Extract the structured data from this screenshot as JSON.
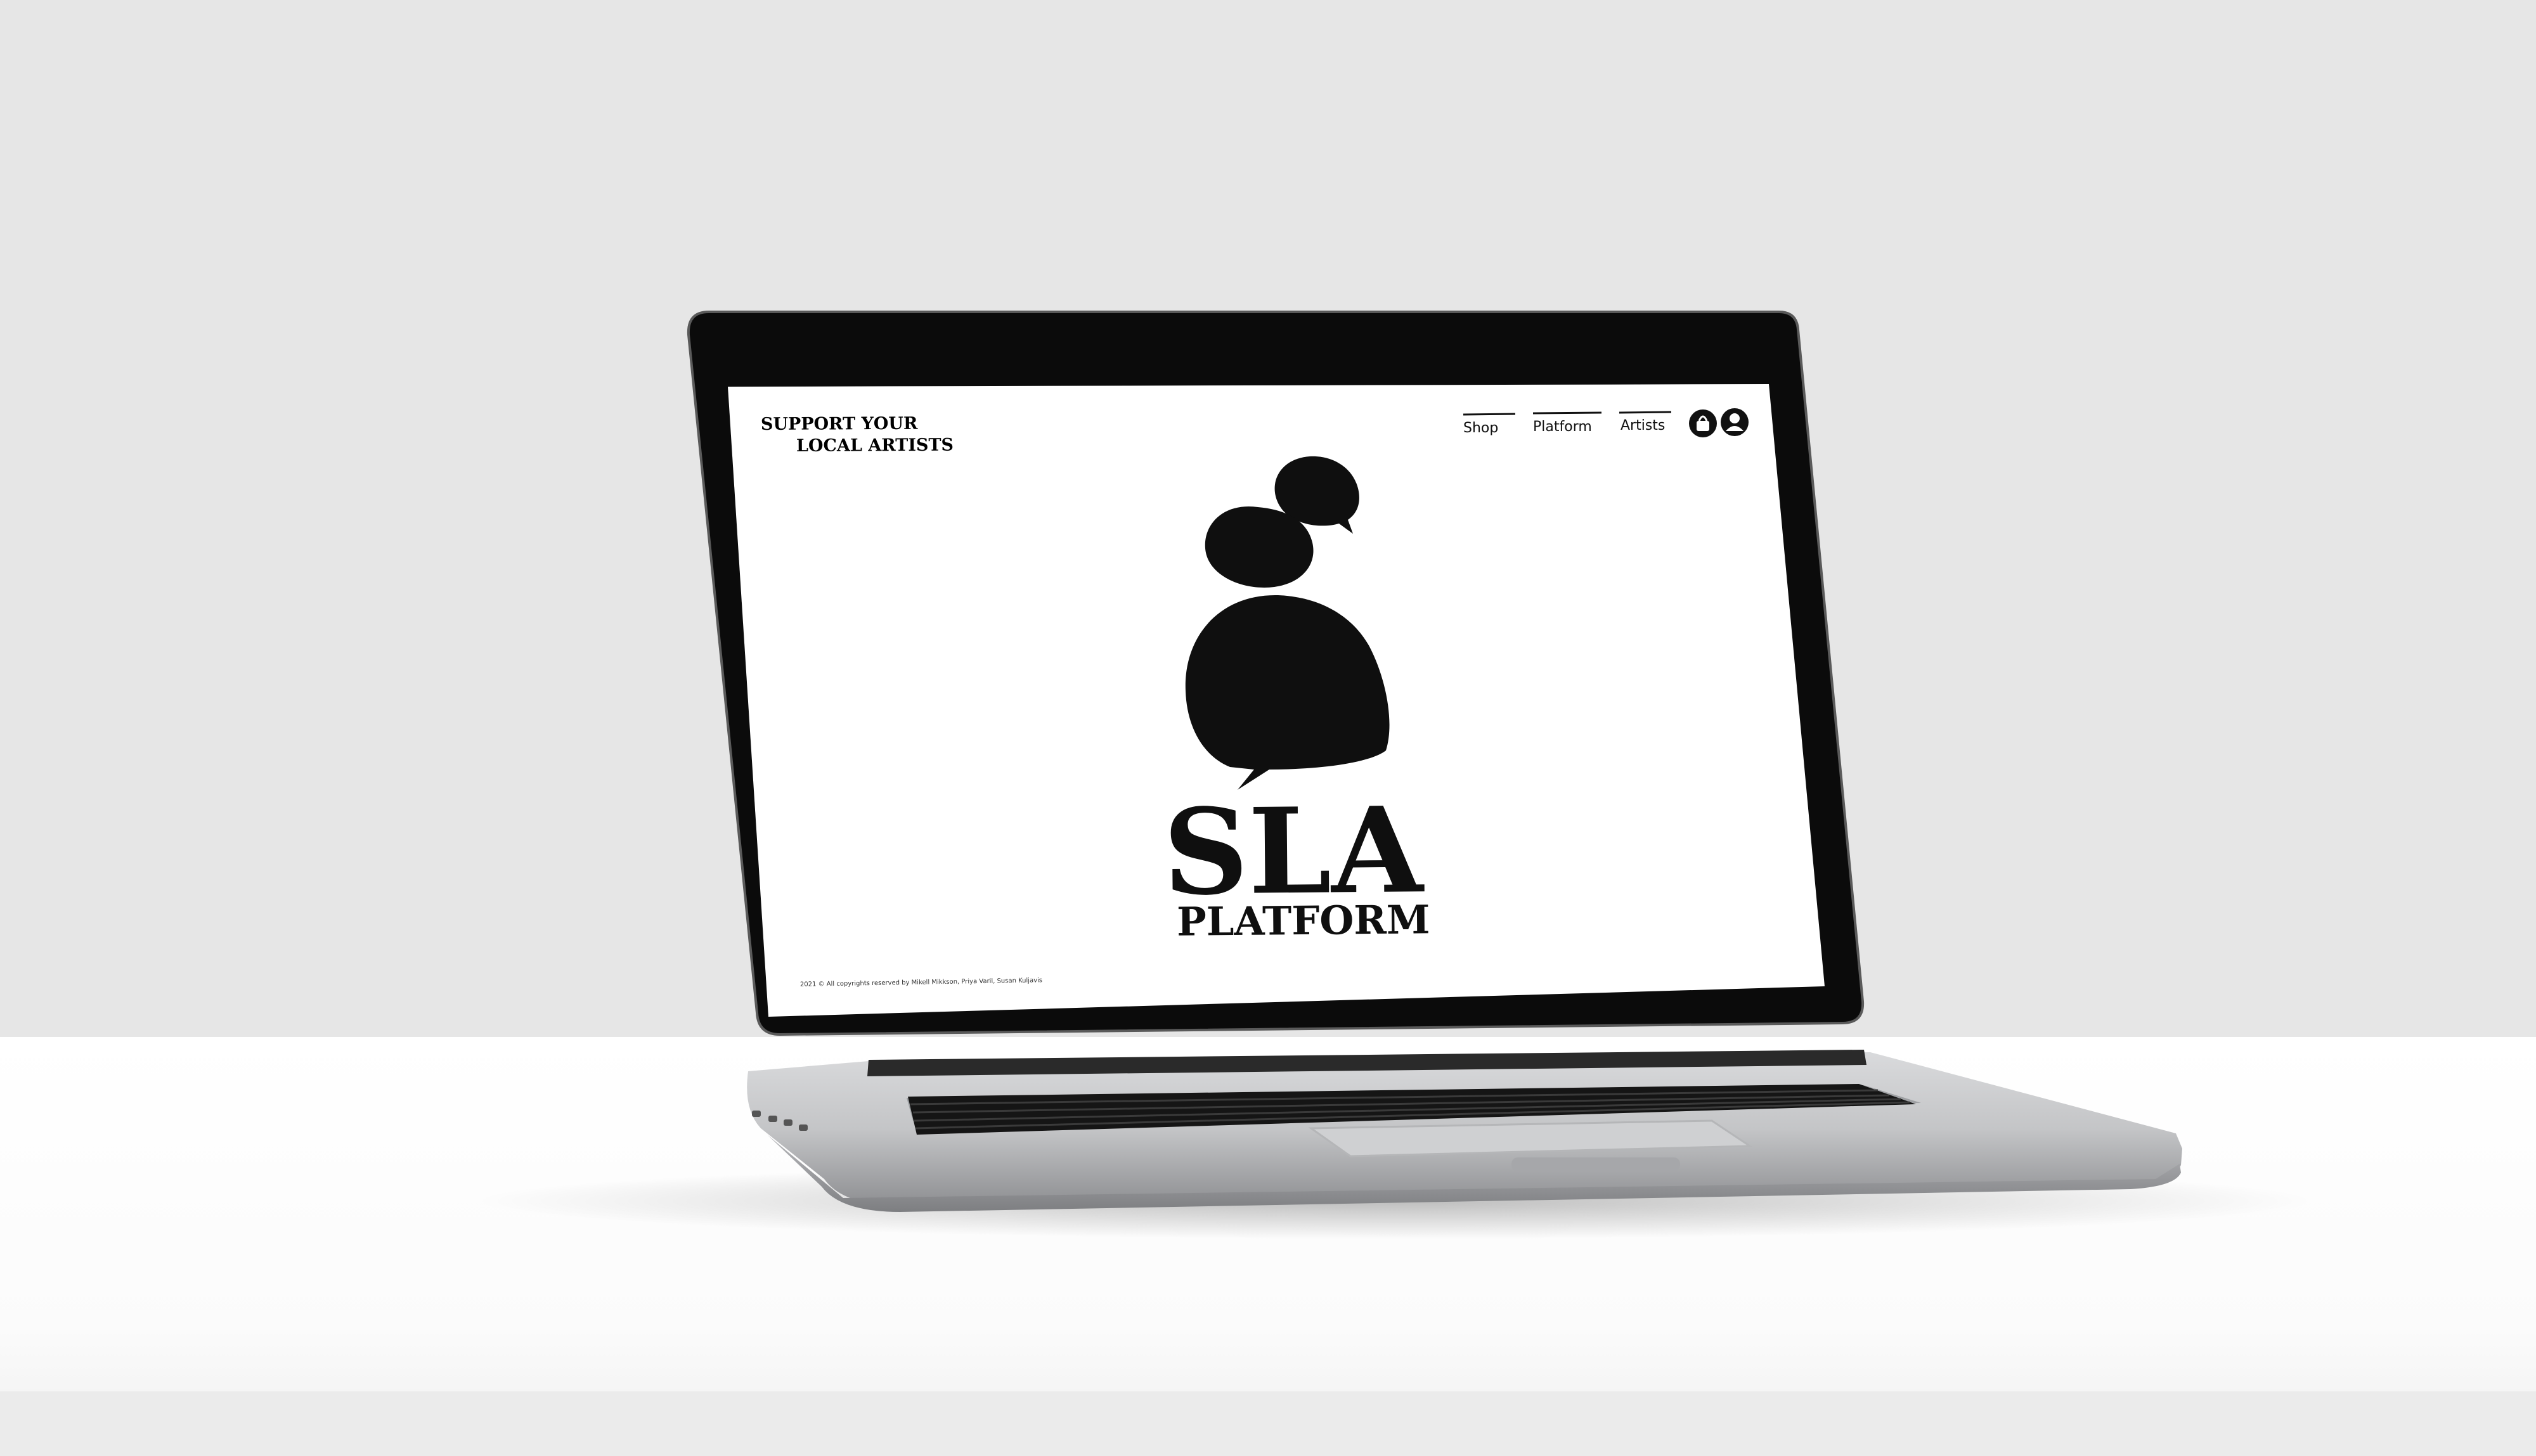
{
  "site": {
    "tagline_line1": "SUPPORT YOUR",
    "tagline_line2": "LOCAL ARTISTS",
    "nav": [
      {
        "label": "Shop"
      },
      {
        "label": "Platform"
      },
      {
        "label": "Artists"
      }
    ],
    "header_icons": [
      "shopping-bag-icon",
      "user-account-icon"
    ],
    "logo_title": "SLA",
    "logo_subtitle": "PLATFORM",
    "footer_text": "2021 © All copyrights reserved by Mikell Mikkson, Priya Varil, Susan Kuljavis"
  },
  "colors": {
    "background_wall": "#e6e6e6",
    "table_surface": "#ffffff",
    "laptop_bezel": "#0b0b0b",
    "laptop_body": "#c7c8ca",
    "screen_bg": "#ffffff",
    "ink": "#0f0f0f"
  }
}
